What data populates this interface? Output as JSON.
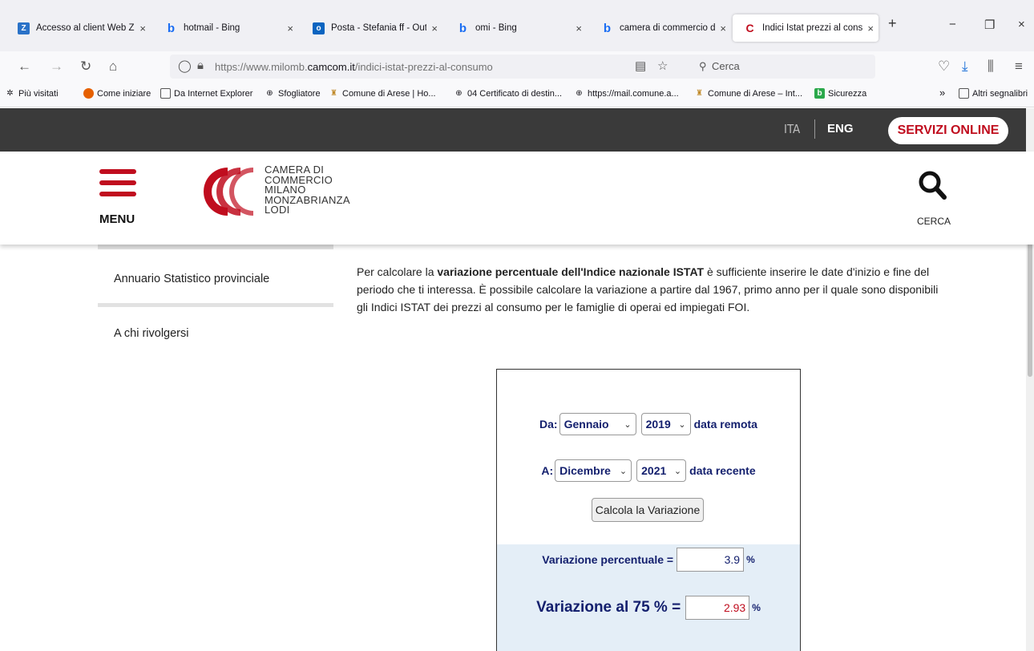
{
  "browser": {
    "tabs": [
      {
        "title": "Accesso al client Web Zir",
        "icon": "zimbra-icon",
        "color": "#2a72c8",
        "letter": "Z"
      },
      {
        "title": "hotmail - Bing",
        "icon": "bing-icon",
        "color": "#1b6ef3",
        "letter": "b"
      },
      {
        "title": "Posta - Stefania ff - Outlo",
        "icon": "outlook-icon",
        "color": "#0a64c0",
        "letter": "o"
      },
      {
        "title": "omi - Bing",
        "icon": "bing-icon",
        "color": "#1b6ef3",
        "letter": "b"
      },
      {
        "title": "camera di commercio di",
        "icon": "bing-icon",
        "color": "#1b6ef3",
        "letter": "b"
      },
      {
        "title": "Indici Istat prezzi al consu",
        "icon": "camcom-icon",
        "color": "#c00d1e",
        "letter": "C"
      }
    ],
    "tab_close_glyph": "×",
    "new_tab_glyph": "+",
    "window_controls": {
      "minimize": "−",
      "restore": "❐",
      "close": "×"
    },
    "url_prefix": "https://www.milomb.",
    "url_domain": "camcom.it",
    "url_path": "/indici-istat-prezzi-al-consumo",
    "search_placeholder": "Cerca",
    "bookmarks": [
      {
        "label": "Più visitati",
        "icon": "gear-icon"
      },
      {
        "label": "Come iniziare",
        "icon": "firefox-icon"
      },
      {
        "label": "Da Internet Explorer",
        "icon": "folder-icon"
      },
      {
        "label": "Sfogliatore",
        "icon": "globe-icon"
      },
      {
        "label": "Comune di Arese | Ho...",
        "icon": "arese-icon"
      },
      {
        "label": "04 Certificato di destin...",
        "icon": "globe-icon"
      },
      {
        "label": "https://mail.comune.a...",
        "icon": "globe-icon"
      },
      {
        "label": "Comune di Arese – Int...",
        "icon": "arese-icon"
      },
      {
        "label": "Sicurezza",
        "icon": "bing-green-icon"
      }
    ],
    "bookmarks_overflow": "»",
    "other_bookmarks": "Altri segnalibri"
  },
  "site": {
    "lang_ita": "ITA",
    "lang_eng": "ENG",
    "servizi_online": "SERVIZI ONLINE",
    "menu_label": "MENU",
    "logo_lines": [
      "CAMERA DI",
      "COMMERCIO",
      "MILANO",
      "MONZABRIANZA",
      "LODI"
    ],
    "search_label": "CERCA",
    "brand_color": "#c00d1e"
  },
  "sidebar": {
    "items": [
      "Annuario Statistico provinciale",
      "A chi rivolgersi"
    ]
  },
  "intro": {
    "before_bold": "Per calcolare la ",
    "bold": "variazione percentuale dell'Indice nazionale ISTAT",
    "after_bold": " è sufficiente inserire le date d'inizio e fine del periodo che ti interessa. È possibile calcolare la variazione a partire dal 1967, primo anno per il quale sono disponibili gli Indici ISTAT dei prezzi al consumo per le famiglie di operai ed impiegati FOI."
  },
  "calculator": {
    "from_label": "Da:",
    "from_month": "Gennaio",
    "from_year": "2019",
    "from_note": "data remota",
    "to_label": "A:",
    "to_month": "Dicembre",
    "to_year": "2021",
    "to_note": "data recente",
    "button": "Calcola la Variazione",
    "pct_label": "Variazione percentuale =",
    "pct_value": "3.9",
    "pct_unit": "%",
    "v75_label": "Variazione al 75 % =",
    "v75_value": "2.93",
    "v75_unit": "%"
  }
}
